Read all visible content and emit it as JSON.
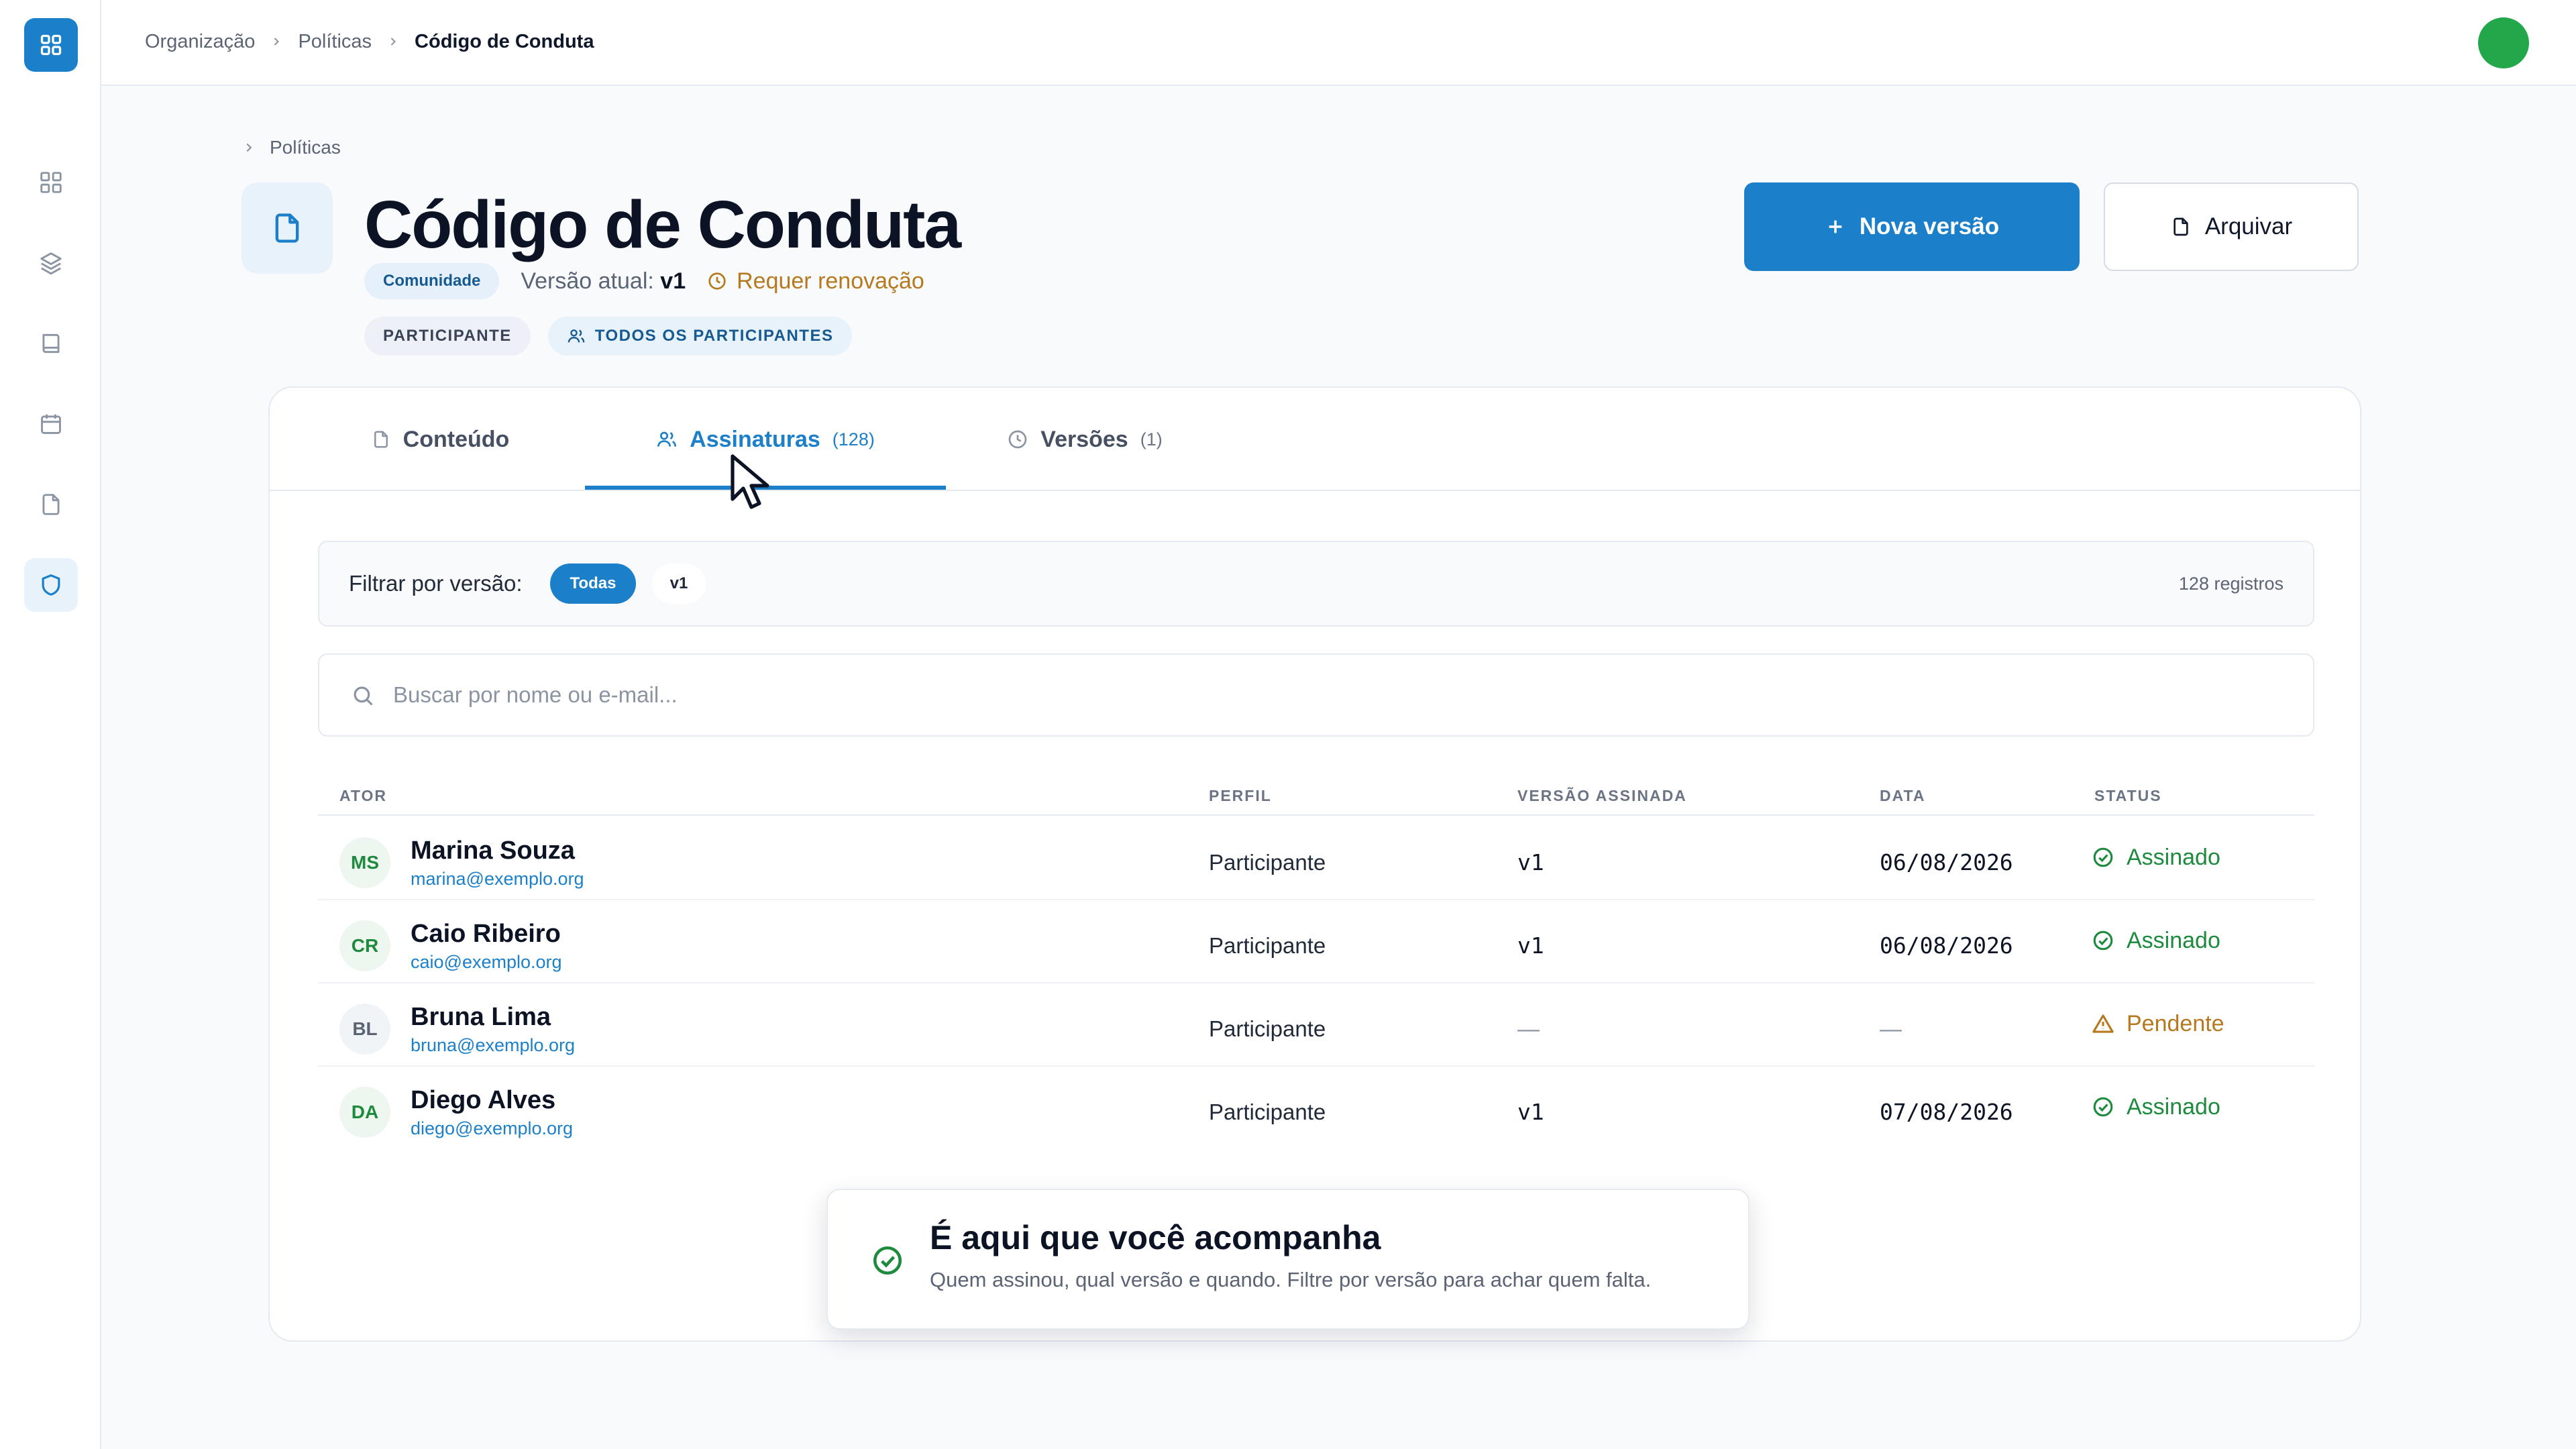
{
  "topbar": {
    "breadcrumbs": [
      "Organização",
      "Políticas",
      "Código de Conduta"
    ]
  },
  "sidebar": {
    "items": [
      {
        "icon": "grid-icon"
      },
      {
        "icon": "layers-icon"
      },
      {
        "icon": "book-icon"
      },
      {
        "icon": "calendar-icon"
      },
      {
        "icon": "document-icon"
      },
      {
        "icon": "shield-icon",
        "active": true
      }
    ]
  },
  "header": {
    "sub_crumb": "Políticas",
    "title": "Código de Conduta",
    "community_chip": "Comunidade",
    "version_label": "Versão atual:",
    "version_value": "v1",
    "renewal": "Requer renovação",
    "tag_participant": "PARTICIPANTE",
    "tag_audience": "TODOS OS PARTICIPANTES",
    "new_version_label": "Nova versão",
    "archive_label": "Arquivar"
  },
  "tabs": [
    {
      "label": "Conteúdo",
      "count": ""
    },
    {
      "label": "Assinaturas",
      "count": "(128)",
      "active": true
    },
    {
      "label": "Versões",
      "count": "(1)"
    }
  ],
  "filter": {
    "label": "Filtrar por versão:",
    "options": [
      "Todas",
      "v1"
    ],
    "selected": "Todas",
    "records": "128 registros"
  },
  "search": {
    "placeholder": "Buscar por nome ou e-mail...",
    "value": ""
  },
  "table": {
    "headers": [
      "ATOR",
      "PERFIL",
      "VERSÃO ASSINADA",
      "DATA",
      "STATUS"
    ],
    "rows": [
      {
        "initials": "MS",
        "name": "Marina Souza",
        "email": "marina@exemplo.org",
        "profile": "Participante",
        "version": "v1",
        "date": "06/08/2026",
        "status": "Assinado",
        "state": "signed"
      },
      {
        "initials": "CR",
        "name": "Caio Ribeiro",
        "email": "caio@exemplo.org",
        "profile": "Participante",
        "version": "v1",
        "date": "06/08/2026",
        "status": "Assinado",
        "state": "signed"
      },
      {
        "initials": "BL",
        "name": "Bruna Lima",
        "email": "bruna@exemplo.org",
        "profile": "Participante",
        "version": "—",
        "date": "—",
        "status": "Pendente",
        "state": "pending"
      },
      {
        "initials": "DA",
        "name": "Diego Alves",
        "email": "diego@exemplo.org",
        "profile": "Participante",
        "version": "v1",
        "date": "07/08/2026",
        "status": "Assinado",
        "state": "signed"
      }
    ]
  },
  "toast": {
    "title": "É aqui que você acompanha",
    "text": "Quem assinou, qual versão e quando. Filtre por versão para achar quem falta."
  },
  "colors": {
    "primary": "#1b7fc9",
    "success": "#1d8a3e",
    "warning": "#b7791f",
    "avatar": "#22a84a"
  }
}
